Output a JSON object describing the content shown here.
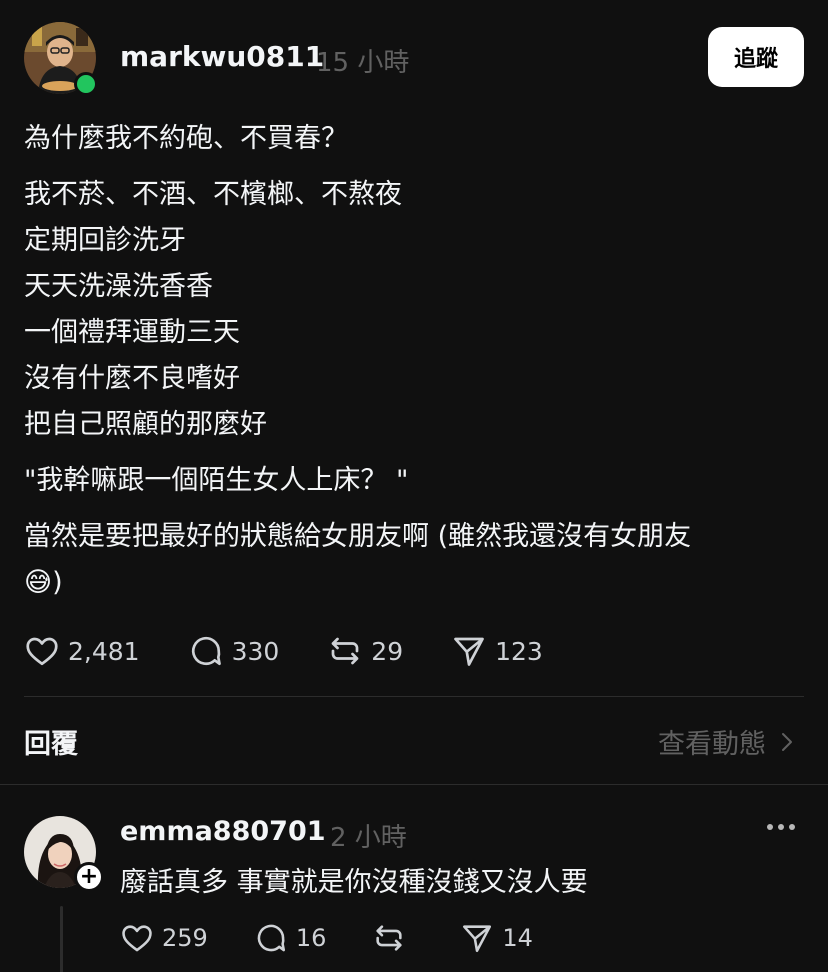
{
  "post": {
    "username": "markwu0811",
    "timestamp": "15 小時",
    "follow_label": "追蹤",
    "title": "為什麼我不約砲、不買春？",
    "lines": [
      "我不菸、不酒、不檳榔、不熬夜",
      "定期回診洗牙",
      "天天洗澡洗香香",
      "一個禮拜運動三天",
      "沒有什麼不良嗜好",
      "把自己照顧的那麼好"
    ],
    "quote": "\"我幹嘛跟一個陌生女人上床？ \"",
    "closing_line1": "當然是要把最好的狀態給女朋友啊 (雖然我還沒有女朋友",
    "closing_emoji": "😅",
    "closing_tail": ")",
    "likes": "2,481",
    "comments": "330",
    "reposts": "29",
    "shares": "123"
  },
  "replies": {
    "title": "回覆",
    "view_activity": "查看動態"
  },
  "comment": {
    "username": "emma880701",
    "timestamp": "2 小時",
    "text": "廢話真多 事實就是你沒種沒錢又沒人要",
    "likes": "259",
    "comments": "16",
    "shares": "14"
  },
  "icons": [
    "heart-icon",
    "comment-icon",
    "repost-icon",
    "share-icon",
    "chevron-right-icon",
    "more-icon",
    "plus-icon"
  ],
  "colors": {
    "background": "#101010",
    "online": "#22c55e",
    "muted": "#616161"
  }
}
